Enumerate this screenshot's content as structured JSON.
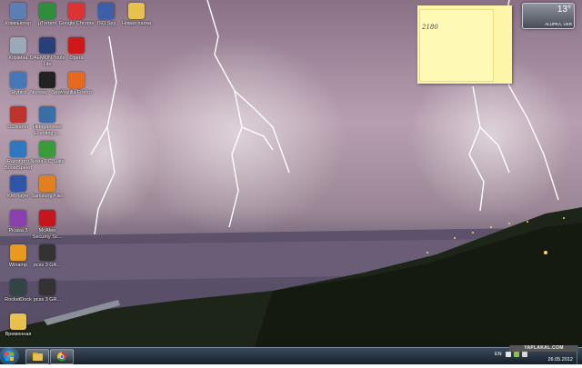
{
  "desktop": {
    "icons": [
      {
        "label": "Компьютер",
        "icon": "computer-icon",
        "color": "#5a7fb5"
      },
      {
        "label": "μTorrent",
        "icon": "utorrent-icon",
        "color": "#2d8f3a"
      },
      {
        "label": "Google Chrome",
        "icon": "chrome-icon",
        "color": "#d33"
      },
      {
        "label": "ISO Spy",
        "icon": "isospy-icon",
        "color": "#3d5fa8"
      },
      {
        "label": "Новая папка",
        "icon": "folder-icon",
        "color": "#e7c04e"
      },
      {
        "label": "Корзина",
        "icon": "recycle-bin-icon",
        "color": "#9aa9b8"
      },
      {
        "label": "DAEMON Tools Lite",
        "icon": "daemon-tools-icon",
        "color": "#2a3e78"
      },
      {
        "label": "Opera",
        "icon": "opera-icon",
        "color": "#d01818"
      },
      {
        "label": "Skybird",
        "icon": "skybird-icon",
        "color": "#4677b8"
      },
      {
        "label": "Norway - Spain",
        "icon": "video-file-icon",
        "color": "#222"
      },
      {
        "label": "Mozilla Firefox",
        "icon": "firefox-icon",
        "color": "#e66a1e"
      },
      {
        "label": "CCleaner",
        "icon": "ccleaner-icon",
        "color": "#c0332d"
      },
      {
        "label": "Hideganswer Eventing v...",
        "icon": "app-icon",
        "color": "#3a6ea6"
      },
      {
        "label": "Razor pro BoostSpeed",
        "icon": "boostspeed-icon",
        "color": "#2f77c0"
      },
      {
        "label": "Nokia PC Suite",
        "icon": "nokia-icon",
        "color": "#3a9b3a"
      },
      {
        "label": "KMPlayer",
        "icon": "kmplayer-icon",
        "color": "#2d56a8"
      },
      {
        "label": "Samsung Kies",
        "icon": "samsung-kies-icon",
        "color": "#e0801f"
      },
      {
        "label": "Picasa 3",
        "icon": "picasa-icon",
        "color": "#8c3fb0"
      },
      {
        "label": "McAfee Security Sc...",
        "icon": "mcafee-icon",
        "color": "#c4161c"
      },
      {
        "label": "Winamp",
        "icon": "winamp-icon",
        "color": "#e89a1f"
      },
      {
        "label": "pcss 3 GR...",
        "icon": "shortcut-icon",
        "color": "#333"
      },
      {
        "label": "RocketDock",
        "icon": "rocketdock-icon",
        "color": "#344"
      },
      {
        "label": "pcss 3 GR...",
        "icon": "shortcut-icon",
        "color": "#333"
      },
      {
        "label": "Временная",
        "icon": "folder-icon",
        "color": "#e7c04e"
      }
    ],
    "sticky_note": {
      "text": "2180"
    },
    "weather": {
      "temperature": "13°",
      "city": "ALUPKA, UKR"
    },
    "watermark": "YAPLAKAL.COM"
  },
  "taskbar": {
    "start_label": "Start",
    "buttons": [
      {
        "icon": "explorer-icon",
        "color": "#e7c04e"
      },
      {
        "icon": "chrome-icon",
        "color": "#d33"
      }
    ],
    "language": "EN",
    "date": "26.05.2012"
  }
}
